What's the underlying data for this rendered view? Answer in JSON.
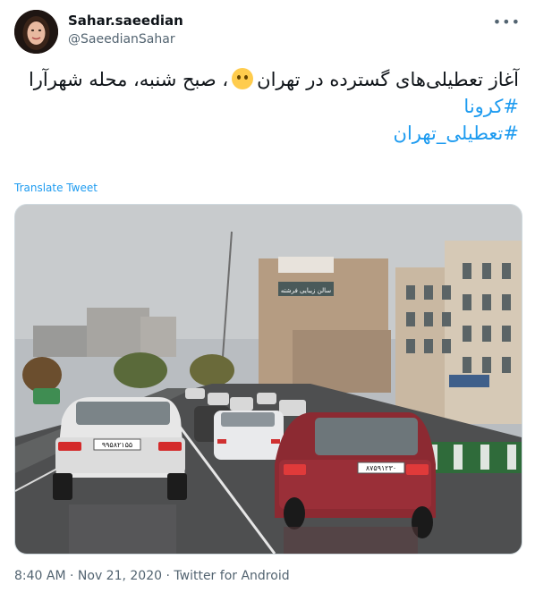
{
  "author": {
    "display_name": "Sahar.saeedian",
    "handle": "@SaeedianSahar"
  },
  "more_icon": "ellipsis-icon",
  "tweet": {
    "line1_before_emoji": "آغاز تعطیلی‌های گسترده در تهران",
    "line1_after_emoji": "، صبح شنبه، محله شهرآرا",
    "hashtag1": "#کرونا",
    "hashtag2": "#تعطیلی_تهران"
  },
  "translate_label": "Translate Tweet",
  "media": {
    "car1_plate": "۹۹۵۸۲۱۵۵",
    "car2_plate": "۸۷۵۹۱۲۳۰",
    "billboard": "سالن زیبایی فرشته"
  },
  "footer": {
    "time": "8:40 AM",
    "sep1": " · ",
    "date": "Nov 21, 2020",
    "sep2": " · ",
    "source": "Twitter for Android"
  }
}
